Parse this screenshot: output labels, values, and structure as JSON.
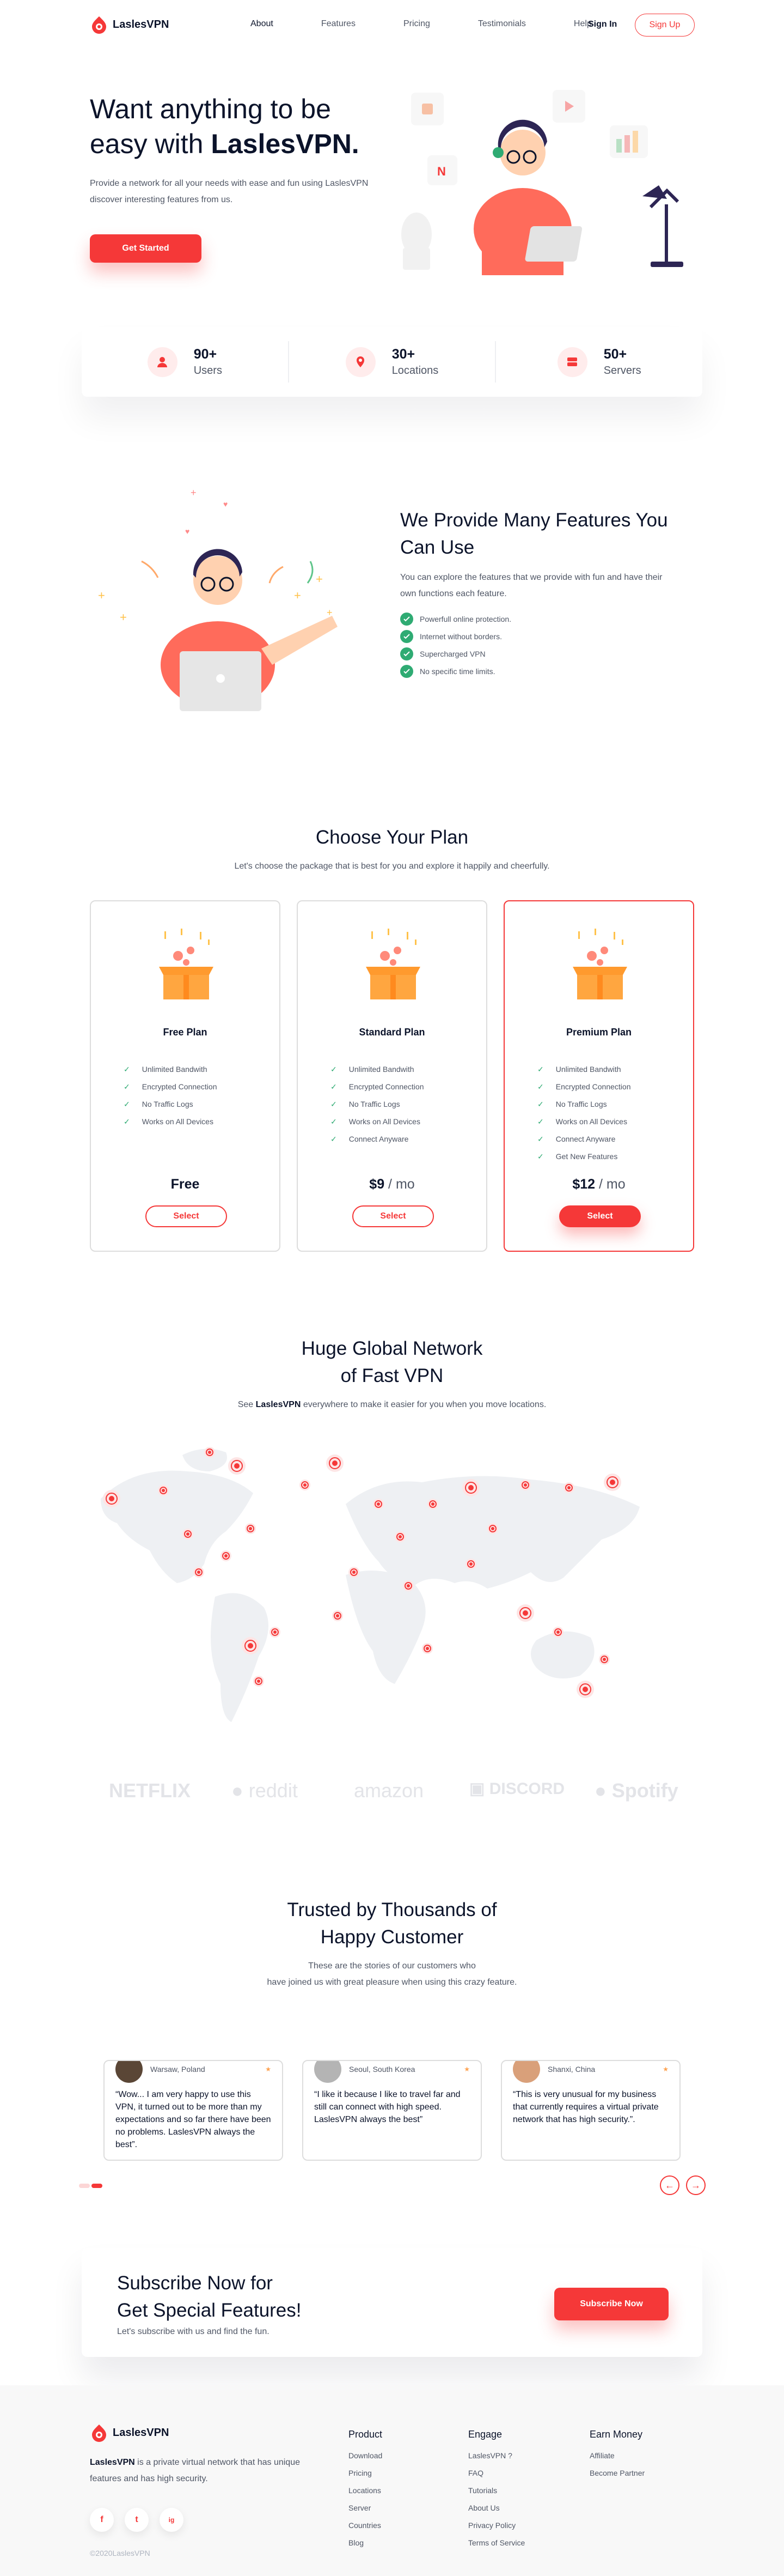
{
  "brand": {
    "name": "LaslesVPN",
    "accent": "#f53838",
    "dark": "#0b132a",
    "gray": "#4f5665",
    "green": "#2fab73"
  },
  "nav": {
    "links": [
      "About",
      "Features",
      "Pricing",
      "Testimonials",
      "Help"
    ],
    "signin": "Sign In",
    "signup": "Sign Up"
  },
  "hero": {
    "title_pre": "Want anything to be easy with ",
    "title_brand": "LaslesVPN.",
    "desc": "Provide a network for all your needs with ease and fun using LaslesVPN discover interesting features from us.",
    "cta": "Get Started"
  },
  "stats": [
    {
      "num": "90+",
      "label": "Users",
      "icon": "user-icon"
    },
    {
      "num": "30+",
      "label": "Locations",
      "icon": "location-pin-icon"
    },
    {
      "num": "50+",
      "label": "Servers",
      "icon": "server-icon"
    }
  ],
  "features": {
    "title": "We Provide Many Features You Can Use",
    "desc": "You can explore the features that we provide with fun and have their own functions each feature.",
    "items": [
      "Powerfull online protection.",
      "Internet without borders.",
      "Supercharged VPN",
      "No specific time limits."
    ]
  },
  "plans": {
    "title": "Choose Your Plan",
    "subtitle": "Let's choose the package that is best for you and explore it happily and cheerfully.",
    "items": [
      {
        "name": "Free Plan",
        "features": [
          "Unlimited Bandwith",
          "Encrypted Connection",
          "No Traffic Logs",
          "Works on All Devices"
        ],
        "price": "Free",
        "per": "",
        "button": "Select"
      },
      {
        "name": "Standard Plan",
        "features": [
          "Unlimited Bandwith",
          "Encrypted Connection",
          "No Traffic Logs",
          "Works on All Devices",
          "Connect Anyware"
        ],
        "price": "$9",
        "per": " / mo",
        "button": "Select"
      },
      {
        "name": "Premium Plan",
        "features": [
          "Unlimited Bandwith",
          "Encrypted Connection",
          "No Traffic Logs",
          "Works on All Devices",
          "Connect Anyware",
          "Get New Features"
        ],
        "price": "$12",
        "per": " / mo",
        "button": "Select"
      }
    ]
  },
  "network": {
    "title_line1": "Huge Global Network",
    "title_line2": "of Fast VPN",
    "sub_pre": "See ",
    "sub_brand": "LaslesVPN",
    "sub_post": " everywhere to make it easier for you when you move locations."
  },
  "sponsors": [
    "NETFLIX",
    "reddit",
    "amazon",
    "DISCORD",
    "Spotify"
  ],
  "testimonials": {
    "title_line1": "Trusted by Thousands of",
    "title_line2": "Happy Customer",
    "sub_line1": "These are the stories of our customers who",
    "sub_line2": "have joined us with great pleasure when using this crazy feature.",
    "items": [
      {
        "location": "Warsaw, Poland",
        "text": "“Wow... I am very happy to use this VPN, it turned out to be more than my expectations and so far there have been no problems. LaslesVPN always the best”."
      },
      {
        "location": "Seoul, South Korea",
        "text": "“I like it because I like to travel far and still can connect with high speed. LaslesVPN always the best”"
      },
      {
        "location": "Shanxi, China",
        "text": "“This is very unusual for my business that currently requires a virtual private network that has high security.”."
      }
    ],
    "prev": "←",
    "next": "→"
  },
  "subscribe": {
    "title_line1": "Subscribe Now for",
    "title_line2": "Get Special Features!",
    "desc": "Let's subscribe with us and find the fun.",
    "button": "Subscribe Now"
  },
  "footer": {
    "brand": "LaslesVPN",
    "desc_rest": " is a private virtual network that has unique features and has high security.",
    "social": [
      "f",
      "t",
      "ig"
    ],
    "copyright": "©2020LaslesVPN",
    "columns": [
      {
        "title": "Product",
        "links": [
          "Download",
          "Pricing",
          "Locations",
          "Server",
          "Countries",
          "Blog"
        ]
      },
      {
        "title": "Engage",
        "links": [
          "LaslesVPN ?",
          "FAQ",
          "Tutorials",
          "About Us",
          "Privacy Policy",
          "Terms of Service"
        ]
      },
      {
        "title": "Earn Money",
        "links": [
          "Affiliate",
          "Become Partner"
        ]
      }
    ]
  }
}
